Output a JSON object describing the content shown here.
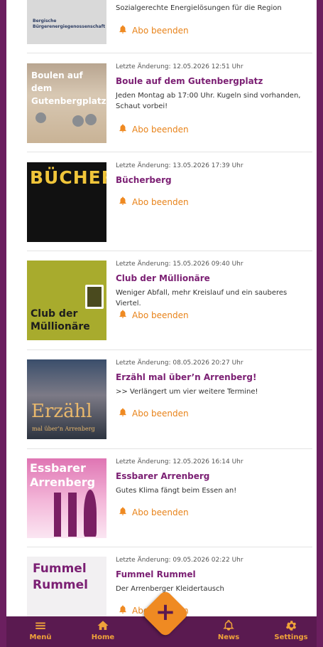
{
  "colors": {
    "primary": "#6b1f5f",
    "accent": "#ef8a22",
    "title": "#7b1f73"
  },
  "action_label": "Abo beenden",
  "items": [
    {
      "meta": "",
      "title": "",
      "desc": "Sozialgerechte Energielösungen für die Region",
      "thumb_text": "Bergische Bürgerenergiegenossenschaft"
    },
    {
      "meta": "Letzte Änderung: 12.05.2026 12:51 Uhr",
      "title": "Boule auf dem Gutenbergplatz",
      "desc": "Jeden Montag ab 17:00 Uhr. Kugeln sind vorhanden, Schaut vorbei!",
      "thumb_text": "Boulen auf dem Gutenbergplatz"
    },
    {
      "meta": "Letzte Änderung: 13.05.2026 17:39 Uhr",
      "title": "Bücherberg",
      "desc": "",
      "thumb_text": "BÜCHERBERG"
    },
    {
      "meta": "Letzte Änderung: 15.05.2026 09:40 Uhr",
      "title": "Club der Müllionäre",
      "desc": "Weniger Abfall, mehr Kreislauf und ein sauberes Viertel.",
      "thumb_text": "Club der Müllionäre"
    },
    {
      "meta": "Letzte Änderung: 08.05.2026 20:27 Uhr",
      "title": "Erzähl mal über’n Arrenberg!",
      "desc": ">> Verlängert um vier weitere Termine!",
      "thumb_text": "Erzähl",
      "thumb_sub": "mal über’n Arrenberg"
    },
    {
      "meta": "Letzte Änderung: 12.05.2026 16:14 Uhr",
      "title": "Essbarer Arrenberg",
      "desc": "Gutes Klima fängt beim Essen an!",
      "thumb_text": "Essbarer Arrenberg"
    },
    {
      "meta": "Letzte Änderung: 09.05.2026 02:22 Uhr",
      "title": "Fummel Rummel",
      "desc": "Der Arrenberger Kleidertausch",
      "thumb_text": "Fummel Rummel"
    }
  ],
  "nav": {
    "menu": "Menü",
    "home": "Home",
    "news": "News",
    "settings": "Settings"
  }
}
